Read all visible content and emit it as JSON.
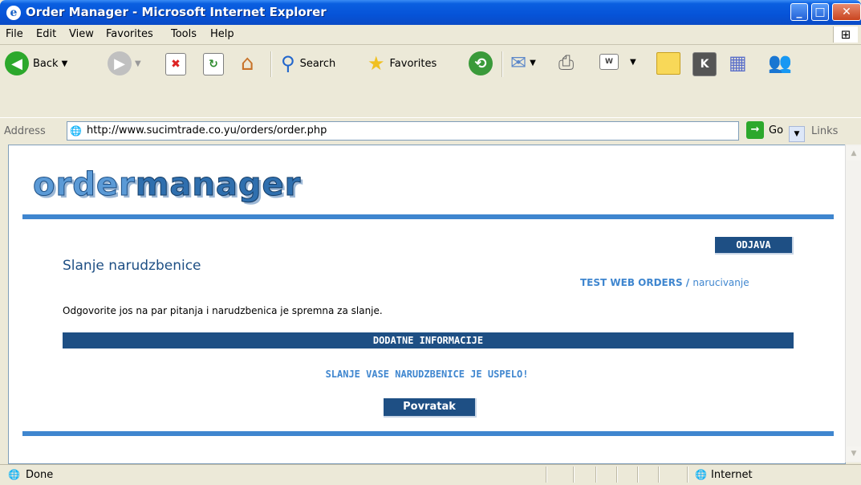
{
  "window": {
    "title": "Order Manager - Microsoft Internet Explorer",
    "min": "_",
    "max": "□",
    "close": "✕"
  },
  "menu": [
    "File",
    "Edit",
    "View",
    "Favorites",
    "Tools",
    "Help"
  ],
  "toolbar": {
    "back": "Back",
    "search": "Search",
    "favorites": "Favorites"
  },
  "address": {
    "label": "Address",
    "url": "http://www.sucimtrade.co.yu/orders/order.php",
    "go": "Go",
    "links": "Links"
  },
  "page": {
    "logo_part1": "order",
    "logo_part2": "manager",
    "logout": "ODJAVA",
    "title": "Slanje narudzbenice",
    "crumb_main": "TEST WEB ORDERS /",
    "crumb_sub": "narucivanje",
    "instruction": "Odgovorite jos na par pitanja i narudzbenica je spremna za slanje.",
    "section": "DODATNE INFORMACIJE",
    "success": "SLANJE VASE NARUDZBENICE JE USPELO!",
    "back": "Povratak"
  },
  "status": {
    "text": "Done",
    "zone": "Internet"
  },
  "colors": {
    "accent": "#1e4f84",
    "link": "#3f86cf"
  }
}
